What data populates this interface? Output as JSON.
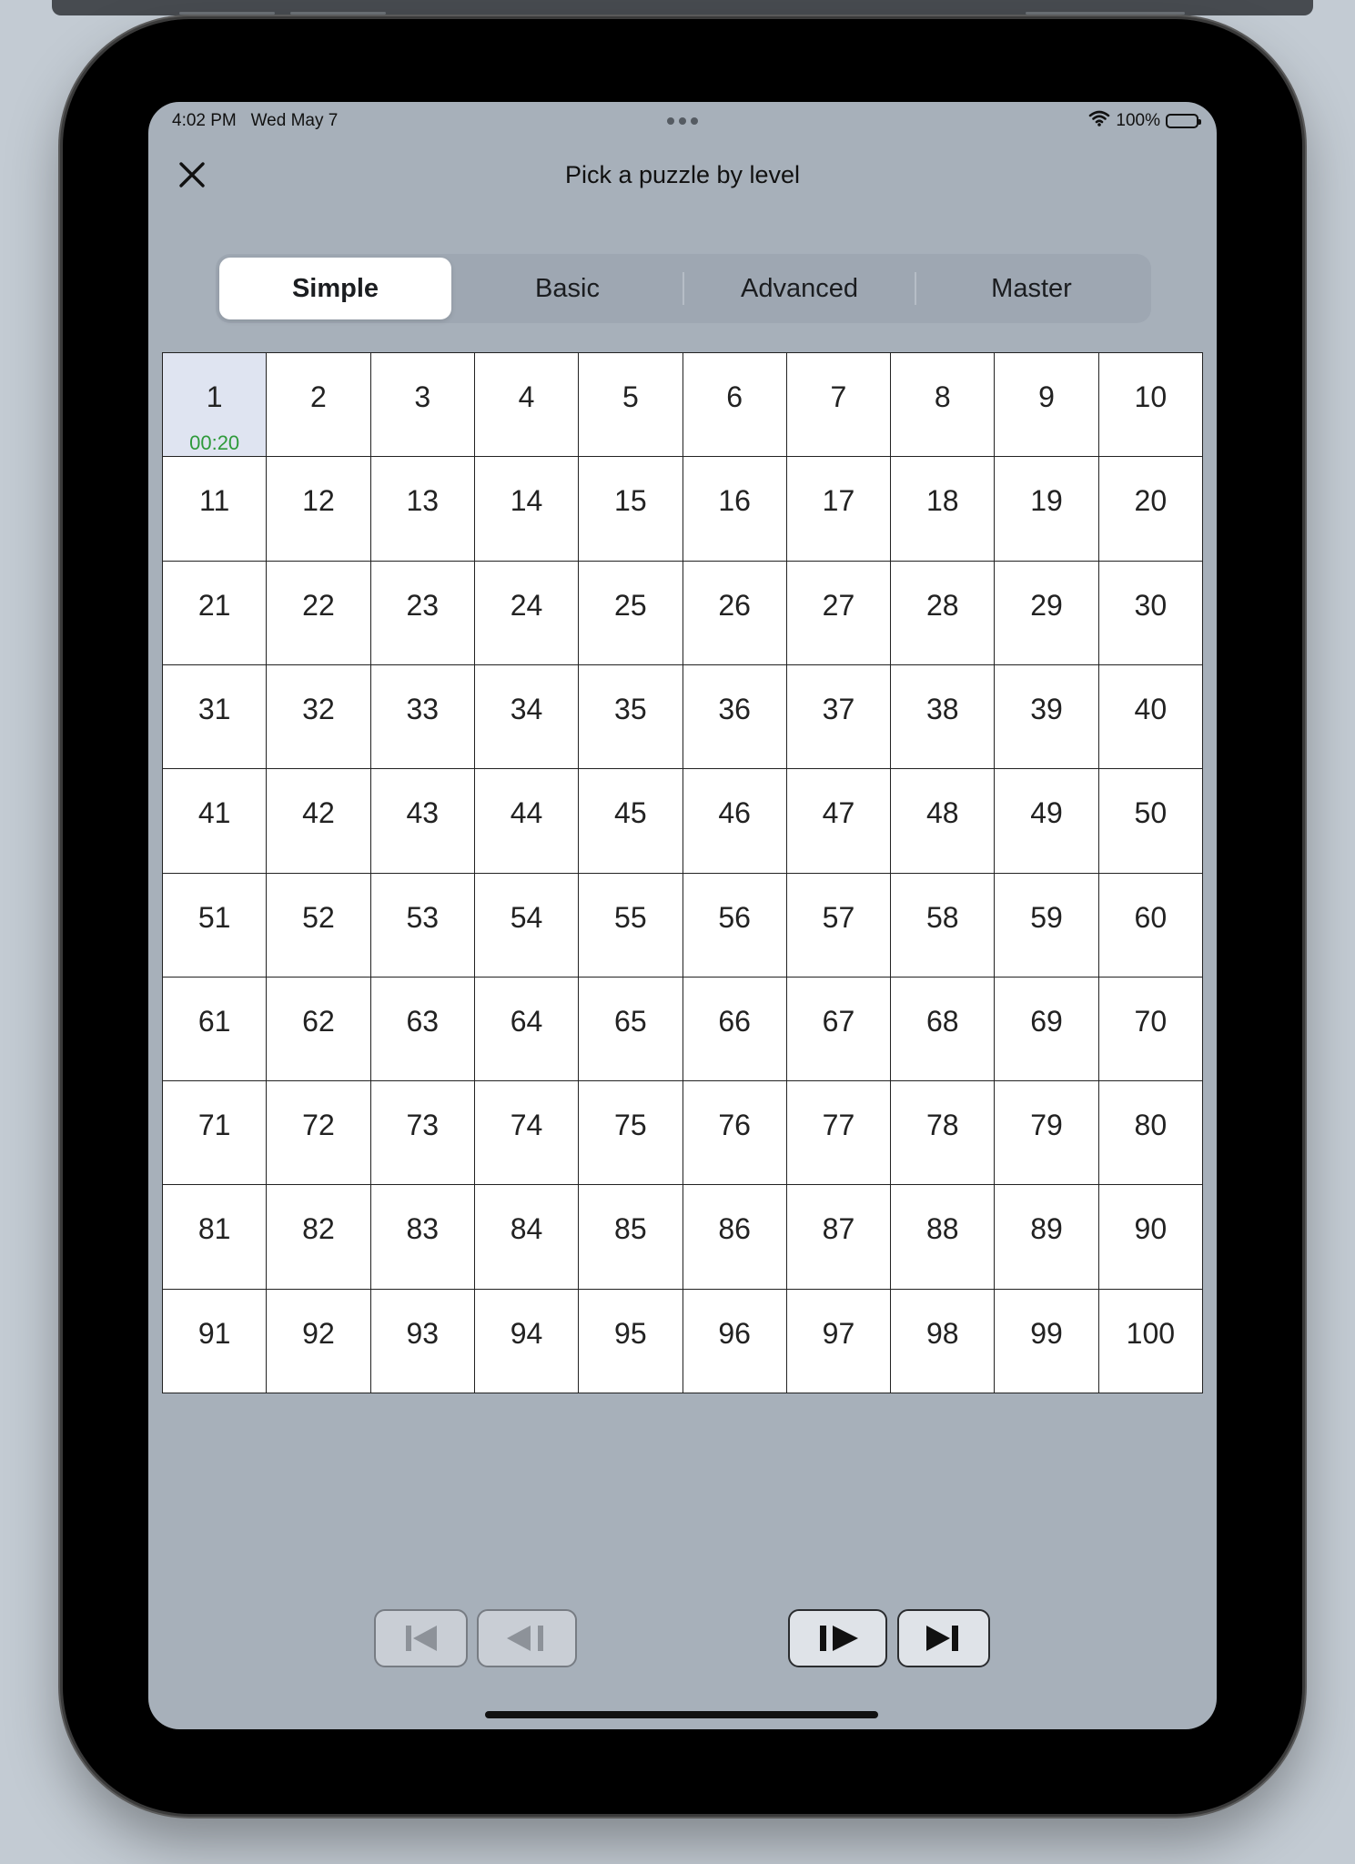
{
  "status_bar": {
    "time_date": "4:02 PM   Wed May 7",
    "battery": "100%"
  },
  "header": {
    "title": "Pick a puzzle by level"
  },
  "level_tabs": [
    {
      "label": "Simple",
      "selected": true
    },
    {
      "label": "Basic",
      "selected": false
    },
    {
      "label": "Advanced",
      "selected": false
    },
    {
      "label": "Master",
      "selected": false
    }
  ],
  "puzzles": [
    {
      "n": "1",
      "time": "00:20",
      "highlight": true
    },
    {
      "n": "2"
    },
    {
      "n": "3"
    },
    {
      "n": "4"
    },
    {
      "n": "5"
    },
    {
      "n": "6"
    },
    {
      "n": "7"
    },
    {
      "n": "8"
    },
    {
      "n": "9"
    },
    {
      "n": "10"
    },
    {
      "n": "11"
    },
    {
      "n": "12"
    },
    {
      "n": "13"
    },
    {
      "n": "14"
    },
    {
      "n": "15"
    },
    {
      "n": "16"
    },
    {
      "n": "17"
    },
    {
      "n": "18"
    },
    {
      "n": "19"
    },
    {
      "n": "20"
    },
    {
      "n": "21"
    },
    {
      "n": "22"
    },
    {
      "n": "23"
    },
    {
      "n": "24"
    },
    {
      "n": "25"
    },
    {
      "n": "26"
    },
    {
      "n": "27"
    },
    {
      "n": "28"
    },
    {
      "n": "29"
    },
    {
      "n": "30"
    },
    {
      "n": "31"
    },
    {
      "n": "32"
    },
    {
      "n": "33"
    },
    {
      "n": "34"
    },
    {
      "n": "35"
    },
    {
      "n": "36"
    },
    {
      "n": "37"
    },
    {
      "n": "38"
    },
    {
      "n": "39"
    },
    {
      "n": "40"
    },
    {
      "n": "41"
    },
    {
      "n": "42"
    },
    {
      "n": "43"
    },
    {
      "n": "44"
    },
    {
      "n": "45"
    },
    {
      "n": "46"
    },
    {
      "n": "47"
    },
    {
      "n": "48"
    },
    {
      "n": "49"
    },
    {
      "n": "50"
    },
    {
      "n": "51"
    },
    {
      "n": "52"
    },
    {
      "n": "53"
    },
    {
      "n": "54"
    },
    {
      "n": "55"
    },
    {
      "n": "56"
    },
    {
      "n": "57"
    },
    {
      "n": "58"
    },
    {
      "n": "59"
    },
    {
      "n": "60"
    },
    {
      "n": "61"
    },
    {
      "n": "62"
    },
    {
      "n": "63"
    },
    {
      "n": "64"
    },
    {
      "n": "65"
    },
    {
      "n": "66"
    },
    {
      "n": "67"
    },
    {
      "n": "68"
    },
    {
      "n": "69"
    },
    {
      "n": "70"
    },
    {
      "n": "71"
    },
    {
      "n": "72"
    },
    {
      "n": "73"
    },
    {
      "n": "74"
    },
    {
      "n": "75"
    },
    {
      "n": "76"
    },
    {
      "n": "77"
    },
    {
      "n": "78"
    },
    {
      "n": "79"
    },
    {
      "n": "80"
    },
    {
      "n": "81"
    },
    {
      "n": "82"
    },
    {
      "n": "83"
    },
    {
      "n": "84"
    },
    {
      "n": "85"
    },
    {
      "n": "86"
    },
    {
      "n": "87"
    },
    {
      "n": "88"
    },
    {
      "n": "89"
    },
    {
      "n": "90"
    },
    {
      "n": "91"
    },
    {
      "n": "92"
    },
    {
      "n": "93"
    },
    {
      "n": "94"
    },
    {
      "n": "95"
    },
    {
      "n": "96"
    },
    {
      "n": "97"
    },
    {
      "n": "98"
    },
    {
      "n": "99"
    },
    {
      "n": "100"
    }
  ],
  "navigation": [
    {
      "name": "first-page-button",
      "icon": "skip-to-start-icon",
      "enabled": false
    },
    {
      "name": "previous-page-button",
      "icon": "step-back-icon",
      "enabled": false
    },
    {
      "name": "next-page-button",
      "icon": "step-forward-icon",
      "enabled": true
    },
    {
      "name": "last-page-button",
      "icon": "skip-to-end-icon",
      "enabled": true
    }
  ],
  "colors": {
    "screen_background": "#a7b0ba",
    "completed_time": "#2e9a3a",
    "highlighted_cell": "#dfe4f1"
  }
}
